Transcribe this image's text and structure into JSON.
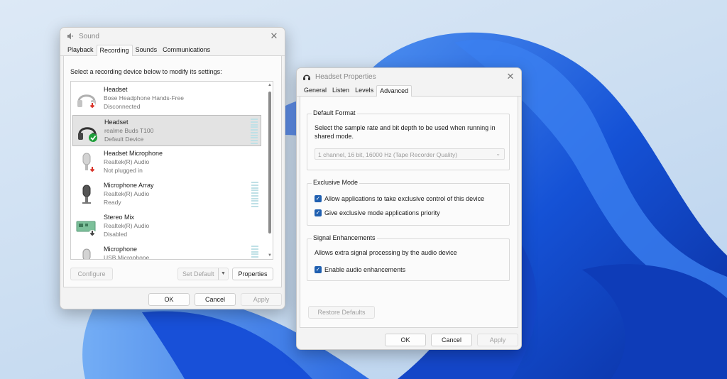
{
  "sound": {
    "title": "Sound",
    "tabs": [
      "Playback",
      "Recording",
      "Sounds",
      "Communications"
    ],
    "instruction": "Select a recording device below to modify its settings:",
    "devices": [
      {
        "name": "Headset",
        "sub": "Bose Headphone Hands-Free",
        "status": "Disconnected"
      },
      {
        "name": "Headset",
        "sub": "realme Buds T100",
        "status": "Default Device"
      },
      {
        "name": "Headset Microphone",
        "sub": "Realtek(R) Audio",
        "status": "Not plugged in"
      },
      {
        "name": "Microphone Array",
        "sub": "Realtek(R) Audio",
        "status": "Ready"
      },
      {
        "name": "Stereo Mix",
        "sub": "Realtek(R) Audio",
        "status": "Disabled"
      },
      {
        "name": "Microphone",
        "sub": "USB Microphone",
        "status": ""
      }
    ],
    "buttons": {
      "configure": "Configure",
      "set_default": "Set Default",
      "properties": "Properties",
      "ok": "OK",
      "cancel": "Cancel",
      "apply": "Apply"
    }
  },
  "props": {
    "title": "Headset Properties",
    "tabs": [
      "General",
      "Listen",
      "Levels",
      "Advanced"
    ],
    "default_format": {
      "label": "Default Format",
      "desc_line1": "Select the sample rate and bit depth to be used when running in",
      "desc_line2": "shared mode.",
      "selected": "1 channel, 16 bit, 16000 Hz (Tape Recorder Quality)"
    },
    "exclusive": {
      "label": "Exclusive Mode",
      "opt1": "Allow applications to take exclusive control of this device",
      "opt2": "Give exclusive mode applications priority"
    },
    "signal": {
      "label": "Signal Enhancements",
      "desc": "Allows extra signal processing by the audio device",
      "opt": "Enable audio enhancements"
    },
    "buttons": {
      "restore": "Restore Defaults",
      "ok": "OK",
      "cancel": "Cancel",
      "apply": "Apply"
    }
  },
  "colors": {
    "accent": "#1f5fb0",
    "check_green": "#1e9e3a",
    "unplug_red": "#d9352b"
  }
}
